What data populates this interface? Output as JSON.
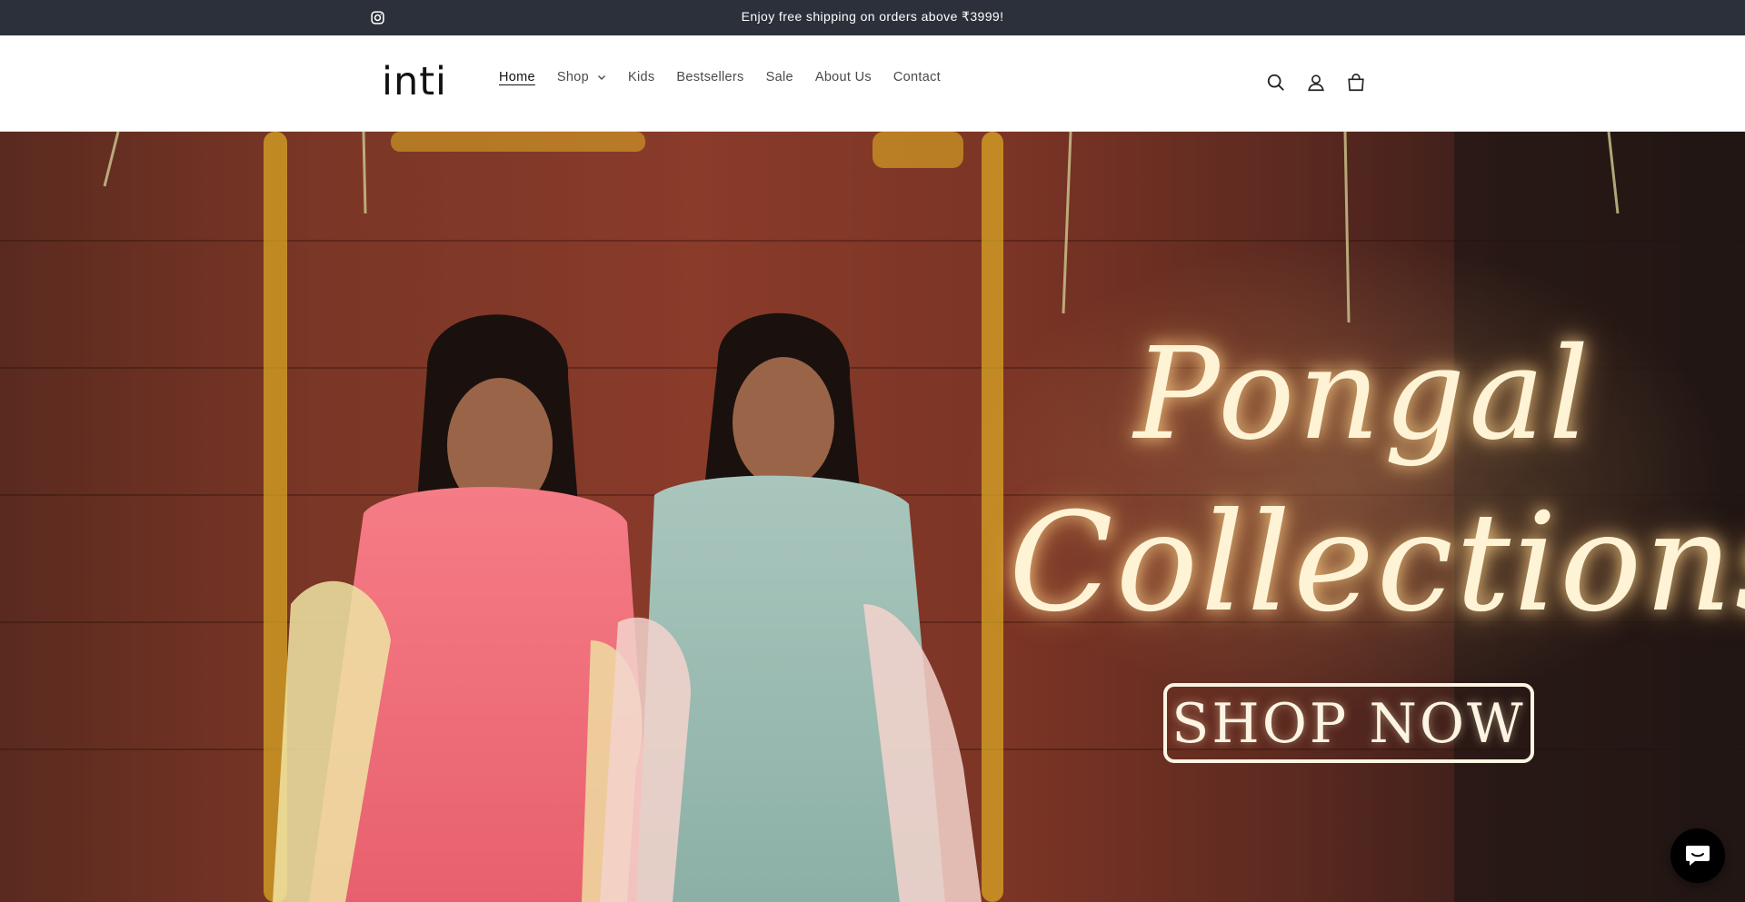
{
  "announcement": {
    "message": "Enjoy free shipping on orders above ₹3999!",
    "social_icon": "instagram-icon"
  },
  "header": {
    "logo_text": "inti",
    "nav": [
      {
        "label": "Home",
        "active": true
      },
      {
        "label": "Shop",
        "has_dropdown": true
      },
      {
        "label": "Kids"
      },
      {
        "label": "Bestsellers"
      },
      {
        "label": "Sale"
      },
      {
        "label": "About Us"
      },
      {
        "label": "Contact"
      }
    ],
    "icons": [
      "search-icon",
      "account-icon",
      "cart-icon"
    ]
  },
  "hero": {
    "title_line1": "Pongal",
    "title_line2": "Collections",
    "cta_label": "SHOP NOW"
  },
  "chat_widget": {
    "icon": "chat-icon"
  },
  "colors": {
    "announcement_bg": "#2b303a",
    "text": "#121212",
    "hero_text": "#fff3d6",
    "chat_bg": "#000000"
  }
}
